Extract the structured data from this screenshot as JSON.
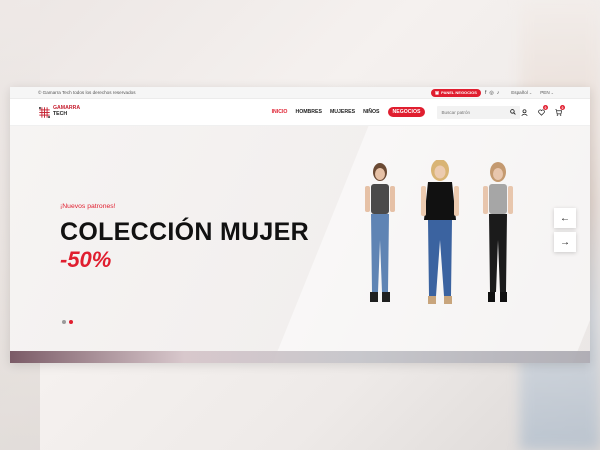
{
  "topbar": {
    "copyright": "© Gamarra Tech todos los derechos reservados",
    "panel_button": "PANEL NEGOCIOS",
    "social": [
      "f",
      "◎",
      "♪"
    ],
    "language": "Español",
    "currency": "PEN"
  },
  "brand": {
    "line1": "GAMARRA",
    "line2": "TECH",
    "accent": "#e01e2f"
  },
  "nav": {
    "items": [
      {
        "label": "INICIO"
      },
      {
        "label": "HOMBRES"
      },
      {
        "label": "MUJERES"
      },
      {
        "label": "NIÑOS"
      }
    ],
    "business_button": "NEGOCIOS"
  },
  "search": {
    "placeholder": "Buscar patrón"
  },
  "header_icons": {
    "wishlist_count": "0",
    "cart_count": "0"
  },
  "hero": {
    "tagline": "¡Nuevos patrones!",
    "headline": "COLECCIÓN MUJER",
    "discount": "-50%",
    "prev_arrow": "←",
    "next_arrow": "→"
  }
}
